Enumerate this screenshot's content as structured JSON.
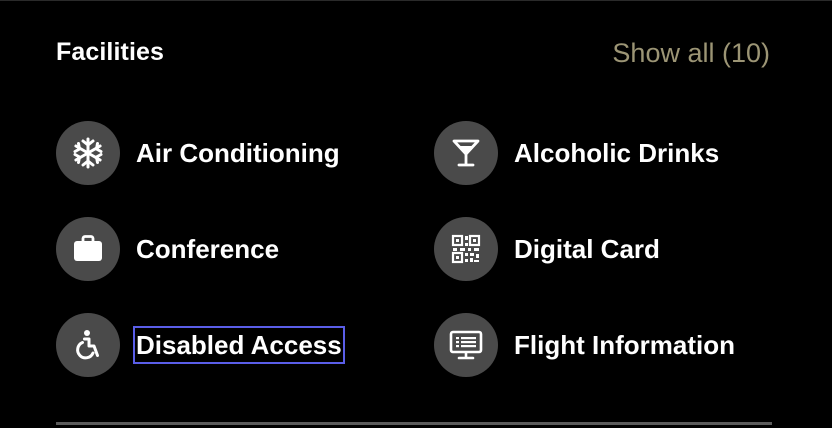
{
  "header": {
    "title": "Facilities",
    "show_all_label": "Show all (10)"
  },
  "facilities": [
    {
      "label": "Air Conditioning",
      "icon": "snowflake-icon"
    },
    {
      "label": "Alcoholic Drinks",
      "icon": "cocktail-glass-icon"
    },
    {
      "label": "Conference",
      "icon": "briefcase-icon"
    },
    {
      "label": "Digital Card",
      "icon": "qr-code-icon"
    },
    {
      "label": "Disabled Access",
      "icon": "wheelchair-icon",
      "focused": true
    },
    {
      "label": "Flight Information",
      "icon": "flight-info-screen-icon"
    }
  ],
  "colors": {
    "background": "#000000",
    "icon_circle": "#4a4a4a",
    "accent_link": "#9c9575",
    "focus_outline": "#5a5ee8"
  }
}
